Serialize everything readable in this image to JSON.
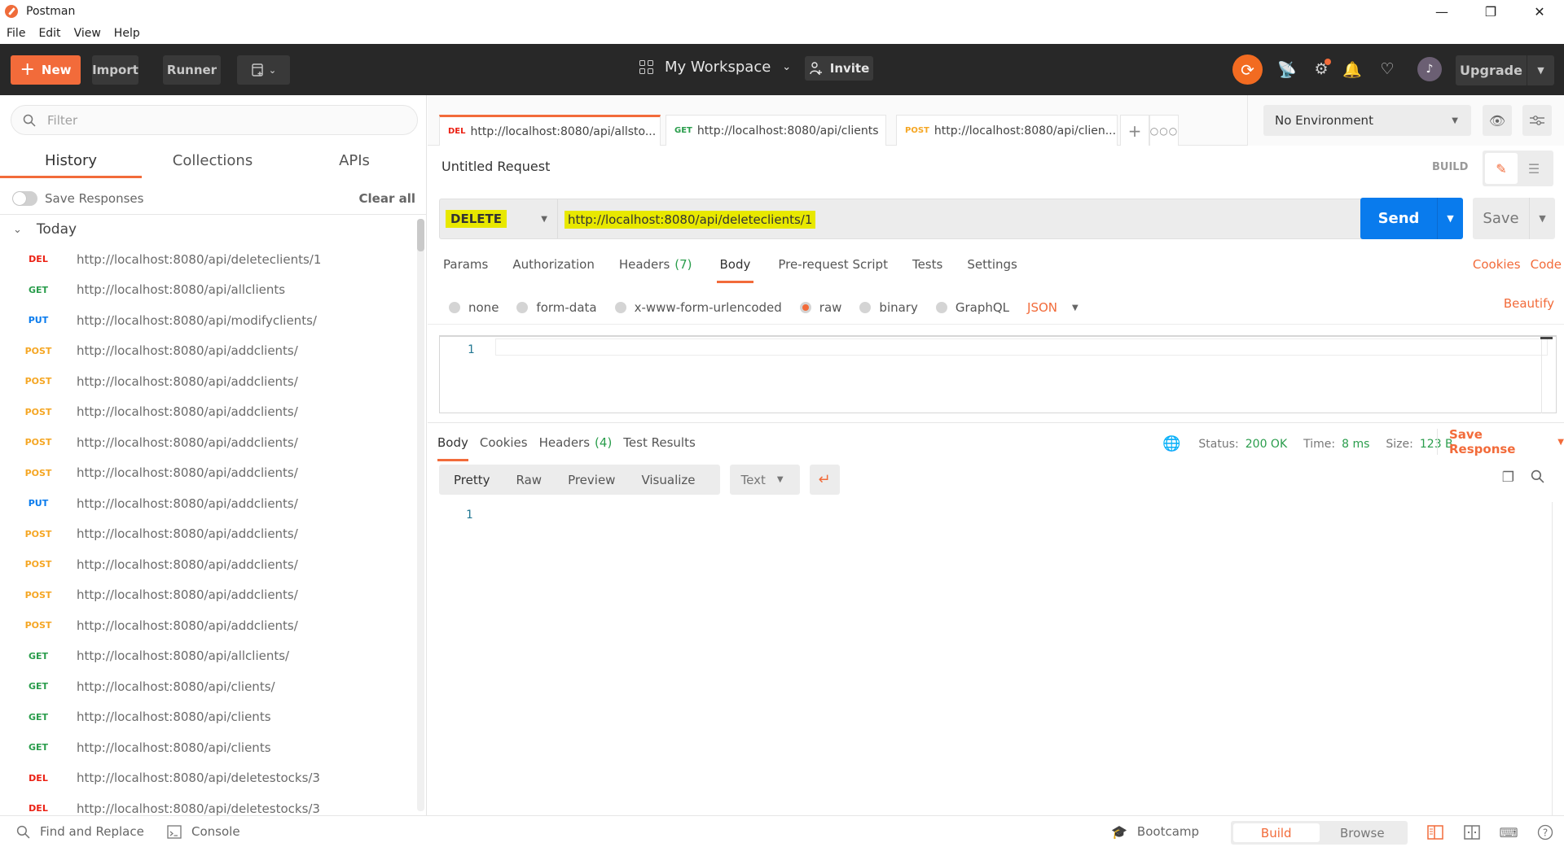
{
  "window": {
    "title": "Postman",
    "controls": {
      "minimize": "—",
      "maximize": "❐",
      "close": "✕"
    }
  },
  "menu": [
    "File",
    "Edit",
    "View",
    "Help"
  ],
  "header": {
    "new_label": "New",
    "import_label": "Import",
    "runner_label": "Runner",
    "workspace_label": "My Workspace",
    "invite_label": "Invite",
    "upgrade_label": "Upgrade",
    "icons": [
      "sync-icon",
      "satellite-icon",
      "settings-icon",
      "bell-icon",
      "heart-icon",
      "avatar"
    ],
    "accent": "#f26b3a"
  },
  "sidebar": {
    "filter_placeholder": "Filter",
    "tabs": [
      {
        "label": "History",
        "active": true
      },
      {
        "label": "Collections",
        "active": false
      },
      {
        "label": "APIs",
        "active": false
      }
    ],
    "save_responses_label": "Save Responses",
    "save_responses_on": false,
    "clear_all_label": "Clear all",
    "group_label": "Today",
    "history": [
      {
        "method": "DEL",
        "url": "http://localhost:8080/api/deleteclients/1"
      },
      {
        "method": "GET",
        "url": "http://localhost:8080/api/allclients"
      },
      {
        "method": "PUT",
        "url": "http://localhost:8080/api/modifyclients/"
      },
      {
        "method": "POST",
        "url": "http://localhost:8080/api/addclients/"
      },
      {
        "method": "POST",
        "url": "http://localhost:8080/api/addclients/"
      },
      {
        "method": "POST",
        "url": "http://localhost:8080/api/addclients/"
      },
      {
        "method": "POST",
        "url": "http://localhost:8080/api/addclients/"
      },
      {
        "method": "POST",
        "url": "http://localhost:8080/api/addclients/"
      },
      {
        "method": "PUT",
        "url": "http://localhost:8080/api/addclients/"
      },
      {
        "method": "POST",
        "url": "http://localhost:8080/api/addclients/"
      },
      {
        "method": "POST",
        "url": "http://localhost:8080/api/addclients/"
      },
      {
        "method": "POST",
        "url": "http://localhost:8080/api/addclients/"
      },
      {
        "method": "POST",
        "url": "http://localhost:8080/api/addclients/"
      },
      {
        "method": "GET",
        "url": "http://localhost:8080/api/allclients/"
      },
      {
        "method": "GET",
        "url": "http://localhost:8080/api/clients/"
      },
      {
        "method": "GET",
        "url": "http://localhost:8080/api/clients"
      },
      {
        "method": "GET",
        "url": "http://localhost:8080/api/clients"
      },
      {
        "method": "DEL",
        "url": "http://localhost:8080/api/deletestocks/3"
      },
      {
        "method": "DEL",
        "url": "http://localhost:8080/api/deletestocks/3"
      }
    ]
  },
  "tabs": [
    {
      "method": "DEL",
      "label": "http://localhost:8080/api/allsto...",
      "active": true,
      "unsaved": true
    },
    {
      "method": "GET",
      "label": "http://localhost:8080/api/clients",
      "active": false,
      "unsaved": true
    },
    {
      "method": "POST",
      "label": "http://localhost:8080/api/clien...",
      "active": false,
      "unsaved": true
    }
  ],
  "environment": {
    "selected": "No Environment"
  },
  "request": {
    "title": "Untitled Request",
    "mode_label": "BUILD",
    "method": "DELETE",
    "url": "http://localhost:8080/api/deleteclients/1",
    "send_label": "Send",
    "save_label": "Save",
    "subtabs": [
      {
        "label": "Params",
        "count": null,
        "active": false
      },
      {
        "label": "Authorization",
        "count": null,
        "active": false
      },
      {
        "label": "Headers",
        "count": "(7)",
        "active": false
      },
      {
        "label": "Body",
        "count": null,
        "active": true
      },
      {
        "label": "Pre-request Script",
        "count": null,
        "active": false
      },
      {
        "label": "Tests",
        "count": null,
        "active": false
      },
      {
        "label": "Settings",
        "count": null,
        "active": false
      }
    ],
    "cookies_label": "Cookies",
    "code_label": "Code",
    "body_types": [
      {
        "label": "none",
        "checked": false
      },
      {
        "label": "form-data",
        "checked": false
      },
      {
        "label": "x-www-form-urlencoded",
        "checked": false
      },
      {
        "label": "raw",
        "checked": true
      },
      {
        "label": "binary",
        "checked": false
      },
      {
        "label": "GraphQL",
        "checked": false
      }
    ],
    "raw_format": "JSON",
    "beautify_label": "Beautify",
    "editor_line": "1"
  },
  "response": {
    "tabs": [
      {
        "label": "Body",
        "count": null,
        "active": true
      },
      {
        "label": "Cookies",
        "count": null,
        "active": false
      },
      {
        "label": "Headers",
        "count": "(4)",
        "active": false
      },
      {
        "label": "Test Results",
        "count": null,
        "active": false
      }
    ],
    "status_label": "Status:",
    "status_value": "200 OK",
    "time_label": "Time:",
    "time_value": "8 ms",
    "size_label": "Size:",
    "size_value": "123 B",
    "save_response_label": "Save Response",
    "views": [
      {
        "label": "Pretty",
        "active": true
      },
      {
        "label": "Raw",
        "active": false
      },
      {
        "label": "Preview",
        "active": false
      },
      {
        "label": "Visualize",
        "active": false
      }
    ],
    "format": "Text",
    "editor_line": "1"
  },
  "footer": {
    "find_replace_label": "Find and Replace",
    "console_label": "Console",
    "bootcamp_label": "Bootcamp",
    "build_label": "Build",
    "browse_label": "Browse"
  }
}
